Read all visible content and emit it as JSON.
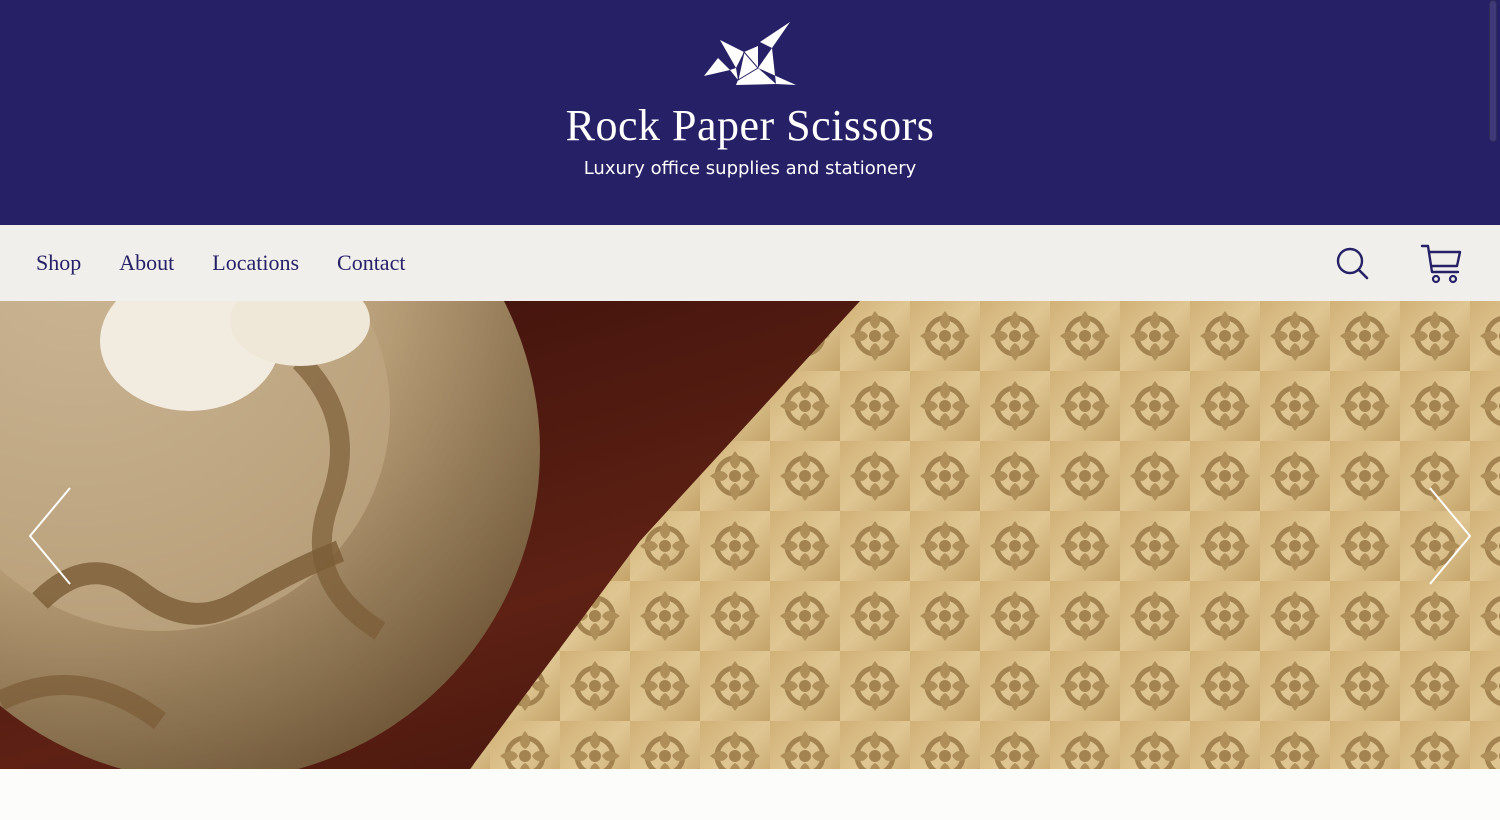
{
  "header": {
    "logo_icon": "origami-crane-icon",
    "title": "Rock Paper Scissors",
    "tagline": "Luxury office supplies and stationery",
    "background_color": "#262066"
  },
  "nav": {
    "items": [
      {
        "label": "Shop"
      },
      {
        "label": "About"
      },
      {
        "label": "Locations"
      },
      {
        "label": "Contact"
      }
    ],
    "search_icon": "search-icon",
    "cart_icon": "cart-icon",
    "text_color": "#262066",
    "background_color": "#f0efec"
  },
  "hero": {
    "image": "decorative stone dish and gold laser-cut lace invitation on dark wood",
    "prev_icon": "chevron-left-icon",
    "next_icon": "chevron-right-icon"
  }
}
